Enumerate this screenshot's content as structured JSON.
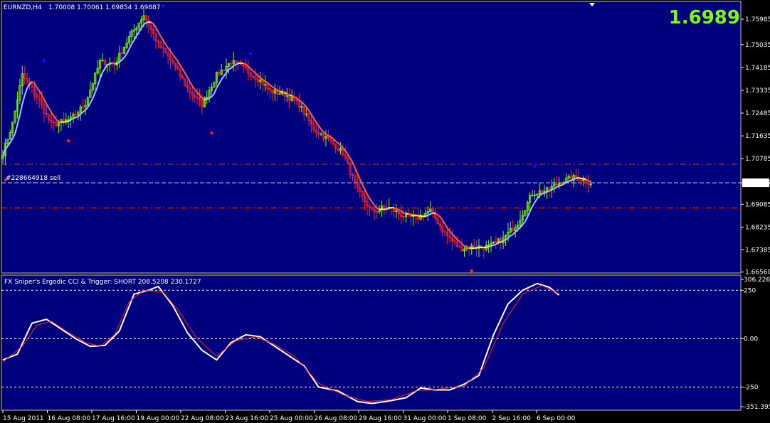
{
  "header": {
    "symbol": "EURNZD,H4",
    "ohlc": "1.70008 1.70061 1.69854 1.69887",
    "big_price": "1.6989"
  },
  "order_label": "#228664918 sell",
  "colors": {
    "background": "#00007f",
    "frame": "#000000",
    "border": "#c0c0c0",
    "bull": "#7cfc00",
    "bear": "#ff2020",
    "ma_up": "#a0c8ff",
    "ma_down": "#ff6040",
    "ma_flat": "#ffff40",
    "ask_line": "#c0f0c0",
    "levels": "#c83030",
    "cci": "#ffffff",
    "trigger": "#ff2020",
    "dot_red": "#ff2020",
    "dot_blue": "#1010ff"
  },
  "chart_data": [
    {
      "type": "candlestick",
      "title": "EURNZD,H4",
      "y_ticks": [
        "1.75985",
        "1.75035",
        "1.74185",
        "1.73335",
        "1.72485",
        "1.71635",
        "1.70785",
        "1.69887",
        "1.69085",
        "1.68235",
        "1.67385",
        "1.66560"
      ],
      "ylim": [
        1.6655,
        1.7625
      ],
      "current_price": 1.69887,
      "order": {
        "label": "#228664918 sell",
        "price": 1.6991
      },
      "horizontal_levels": [
        1.7058,
        1.6895
      ],
      "approx_close_path": [
        {
          "i": 0,
          "v": 1.71
        },
        {
          "i": 4,
          "v": 1.721
        },
        {
          "i": 8,
          "v": 1.739
        },
        {
          "i": 14,
          "v": 1.731
        },
        {
          "i": 20,
          "v": 1.7205
        },
        {
          "i": 28,
          "v": 1.7225
        },
        {
          "i": 34,
          "v": 1.7285
        },
        {
          "i": 40,
          "v": 1.744
        },
        {
          "i": 46,
          "v": 1.743
        },
        {
          "i": 52,
          "v": 1.753
        },
        {
          "i": 58,
          "v": 1.7615
        },
        {
          "i": 64,
          "v": 1.7505
        },
        {
          "i": 70,
          "v": 1.7435
        },
        {
          "i": 76,
          "v": 1.734
        },
        {
          "i": 82,
          "v": 1.728
        },
        {
          "i": 88,
          "v": 1.739
        },
        {
          "i": 94,
          "v": 1.744
        },
        {
          "i": 100,
          "v": 1.741
        },
        {
          "i": 106,
          "v": 1.737
        },
        {
          "i": 110,
          "v": 1.733
        },
        {
          "i": 116,
          "v": 1.732
        },
        {
          "i": 122,
          "v": 1.728
        },
        {
          "i": 128,
          "v": 1.719
        },
        {
          "i": 134,
          "v": 1.715
        },
        {
          "i": 140,
          "v": 1.71
        },
        {
          "i": 146,
          "v": 1.696
        },
        {
          "i": 152,
          "v": 1.688
        },
        {
          "i": 158,
          "v": 1.69
        },
        {
          "i": 164,
          "v": 1.687
        },
        {
          "i": 170,
          "v": 1.6855
        },
        {
          "i": 176,
          "v": 1.6885
        },
        {
          "i": 182,
          "v": 1.68
        },
        {
          "i": 188,
          "v": 1.6745
        },
        {
          "i": 194,
          "v": 1.675
        },
        {
          "i": 200,
          "v": 1.675
        },
        {
          "i": 206,
          "v": 1.678
        },
        {
          "i": 212,
          "v": 1.684
        },
        {
          "i": 218,
          "v": 1.695
        },
        {
          "i": 224,
          "v": 1.696
        },
        {
          "i": 230,
          "v": 1.6995
        },
        {
          "i": 236,
          "v": 1.701
        },
        {
          "i": 242,
          "v": 1.6989
        }
      ],
      "bar_count": 243,
      "fractal_dots": [
        {
          "i": 17,
          "v": 1.7445,
          "color": "blue"
        },
        {
          "i": 27,
          "v": 1.7145,
          "color": "red"
        },
        {
          "i": 66,
          "v": 1.7648,
          "color": "blue"
        },
        {
          "i": 86,
          "v": 1.7175,
          "color": "red"
        },
        {
          "i": 102,
          "v": 1.747,
          "color": "blue"
        },
        {
          "i": 193,
          "v": 1.666,
          "color": "red"
        },
        {
          "i": 219,
          "v": 1.705,
          "color": "blue"
        }
      ]
    },
    {
      "type": "line",
      "title": "FX Sniper's Ergodic CCI & Trigger: SHORT 208.5208 230.1727",
      "y_ticks": [
        "306.2261",
        "250",
        "0.00",
        "-250",
        "-351.395"
      ],
      "ylim": [
        -351.395,
        306.2261
      ],
      "levels": [
        250,
        0,
        -250
      ],
      "x_tick_labels": [
        "15 Aug 2011",
        "16 Aug 08:00",
        "17 Aug 16:00",
        "19 Aug 00:00",
        "22 Aug 08:00",
        "23 Aug 16:00",
        "25 Aug 00:00",
        "26 Aug 08:00",
        "29 Aug 16:00",
        "31 Aug 00:00",
        "1 Sep 08:00",
        "2 Sep 16:00",
        "6 Sep 00:00"
      ],
      "series": [
        {
          "name": "Ergodic CCI",
          "points": [
            {
              "i": 0,
              "v": -110
            },
            {
              "i": 6,
              "v": -80
            },
            {
              "i": 12,
              "v": 80
            },
            {
              "i": 18,
              "v": 100
            },
            {
              "i": 24,
              "v": 50
            },
            {
              "i": 30,
              "v": 0
            },
            {
              "i": 36,
              "v": -40
            },
            {
              "i": 42,
              "v": -35
            },
            {
              "i": 48,
              "v": 40
            },
            {
              "i": 54,
              "v": 230
            },
            {
              "i": 60,
              "v": 250
            },
            {
              "i": 64,
              "v": 270
            },
            {
              "i": 70,
              "v": 170
            },
            {
              "i": 76,
              "v": 30
            },
            {
              "i": 82,
              "v": -60
            },
            {
              "i": 88,
              "v": -110
            },
            {
              "i": 94,
              "v": -20
            },
            {
              "i": 100,
              "v": 20
            },
            {
              "i": 106,
              "v": 10
            },
            {
              "i": 112,
              "v": -40
            },
            {
              "i": 118,
              "v": -90
            },
            {
              "i": 124,
              "v": -140
            },
            {
              "i": 130,
              "v": -250
            },
            {
              "i": 138,
              "v": -270
            },
            {
              "i": 146,
              "v": -325
            },
            {
              "i": 152,
              "v": -335
            },
            {
              "i": 160,
              "v": -320
            },
            {
              "i": 166,
              "v": -305
            },
            {
              "i": 172,
              "v": -255
            },
            {
              "i": 178,
              "v": -265
            },
            {
              "i": 184,
              "v": -265
            },
            {
              "i": 190,
              "v": -235
            },
            {
              "i": 196,
              "v": -190
            },
            {
              "i": 202,
              "v": 20
            },
            {
              "i": 208,
              "v": 180
            },
            {
              "i": 214,
              "v": 250
            },
            {
              "i": 220,
              "v": 285
            },
            {
              "i": 225,
              "v": 265
            },
            {
              "i": 229,
              "v": 225
            }
          ]
        },
        {
          "name": "Trigger",
          "points": [
            {
              "i": 0,
              "v": -120
            },
            {
              "i": 8,
              "v": -40
            },
            {
              "i": 14,
              "v": 70
            },
            {
              "i": 20,
              "v": 90
            },
            {
              "i": 26,
              "v": 40
            },
            {
              "i": 34,
              "v": -20
            },
            {
              "i": 40,
              "v": -40
            },
            {
              "i": 46,
              "v": 20
            },
            {
              "i": 52,
              "v": 190
            },
            {
              "i": 58,
              "v": 250
            },
            {
              "i": 66,
              "v": 240
            },
            {
              "i": 72,
              "v": 150
            },
            {
              "i": 80,
              "v": 0
            },
            {
              "i": 88,
              "v": -90
            },
            {
              "i": 96,
              "v": -10
            },
            {
              "i": 104,
              "v": 10
            },
            {
              "i": 112,
              "v": -30
            },
            {
              "i": 120,
              "v": -90
            },
            {
              "i": 130,
              "v": -230
            },
            {
              "i": 140,
              "v": -290
            },
            {
              "i": 150,
              "v": -325
            },
            {
              "i": 160,
              "v": -315
            },
            {
              "i": 170,
              "v": -270
            },
            {
              "i": 180,
              "v": -260
            },
            {
              "i": 190,
              "v": -245
            },
            {
              "i": 198,
              "v": -150
            },
            {
              "i": 206,
              "v": 80
            },
            {
              "i": 214,
              "v": 230
            },
            {
              "i": 222,
              "v": 275
            },
            {
              "i": 229,
              "v": 232
            }
          ]
        }
      ]
    }
  ]
}
